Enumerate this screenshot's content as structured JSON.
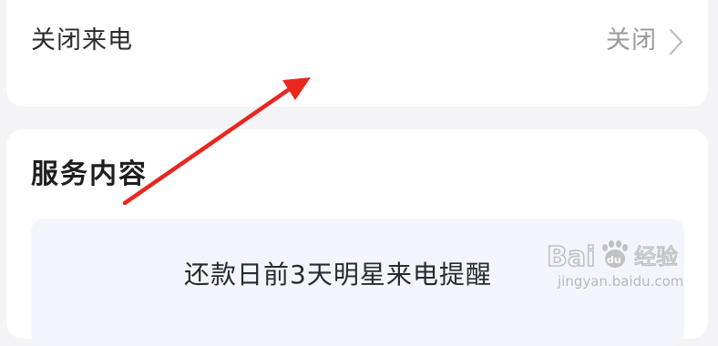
{
  "setting": {
    "label": "关闭来电",
    "value": "关闭",
    "chevron_icon": "chevron-right-icon"
  },
  "service": {
    "title": "服务内容",
    "description": "还款日前3天明星来电提醒"
  },
  "annotation": {
    "type": "arrow",
    "color": "#e8271f"
  },
  "watermark": {
    "brand": "Baidu经验",
    "url": "jingyan.baidu.com"
  },
  "colors": {
    "background": "#f4f4f6",
    "card": "#ffffff",
    "info_box": "#f2f6fc",
    "text_primary": "#2b2b2b",
    "text_secondary": "#9a9a9a"
  }
}
